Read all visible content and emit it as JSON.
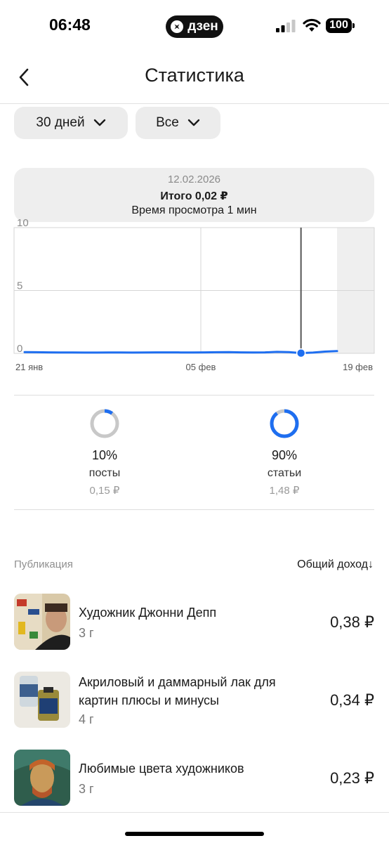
{
  "status_bar": {
    "time": "06:48",
    "app_badge": "дзен",
    "battery": "100"
  },
  "header": {
    "title": "Статистика",
    "back_icon": "chevron-left-icon"
  },
  "filters": {
    "period": "30 дней",
    "content_type": "Все"
  },
  "chart": {
    "tooltip_date": "12.02.2026",
    "tooltip_total": "Итого 0,02 ₽",
    "tooltip_time": "Время просмотра 1 мин"
  },
  "chart_data": {
    "type": "line",
    "y_ticks": [
      "10",
      "5",
      "0"
    ],
    "ylim": [
      0,
      10
    ],
    "x_tick_labels": [
      "21 янв",
      "05 фев",
      "19 фев"
    ],
    "series": [
      {
        "values": [
          0.1,
          0.09,
          0.08,
          0.07,
          0.07,
          0.06,
          0.06,
          0.07,
          0.07,
          0.06,
          0.07,
          0.08,
          0.08,
          0.07,
          0.07,
          0.08,
          0.09,
          0.1,
          0.08,
          0.07,
          0.08,
          0.12,
          0.1,
          0.02,
          0.06,
          0.14,
          0.18
        ],
        "color": "#1e6ef0"
      }
    ],
    "selected_index": 23,
    "grid": true
  },
  "split": [
    {
      "percent": "10%",
      "label": "посты",
      "amount": "0,15 ₽",
      "fraction": 0.1,
      "color": "#1e6ef0"
    },
    {
      "percent": "90%",
      "label": "статьи",
      "amount": "1,48 ₽",
      "fraction": 0.9,
      "color": "#1e6ef0"
    }
  ],
  "list": {
    "header_left": "Публикация",
    "header_right": "Общий доход↓",
    "items": [
      {
        "title": "Художник Джонни Депп",
        "age": "3 г",
        "income": "0,38 ₽"
      },
      {
        "title": "Акриловый и даммарный лак для картин плюсы и минусы",
        "age": "4 г",
        "income": "0,34 ₽"
      },
      {
        "title": "Любимые цвета художников",
        "age": "3 г",
        "income": "0,23 ₽"
      }
    ]
  }
}
